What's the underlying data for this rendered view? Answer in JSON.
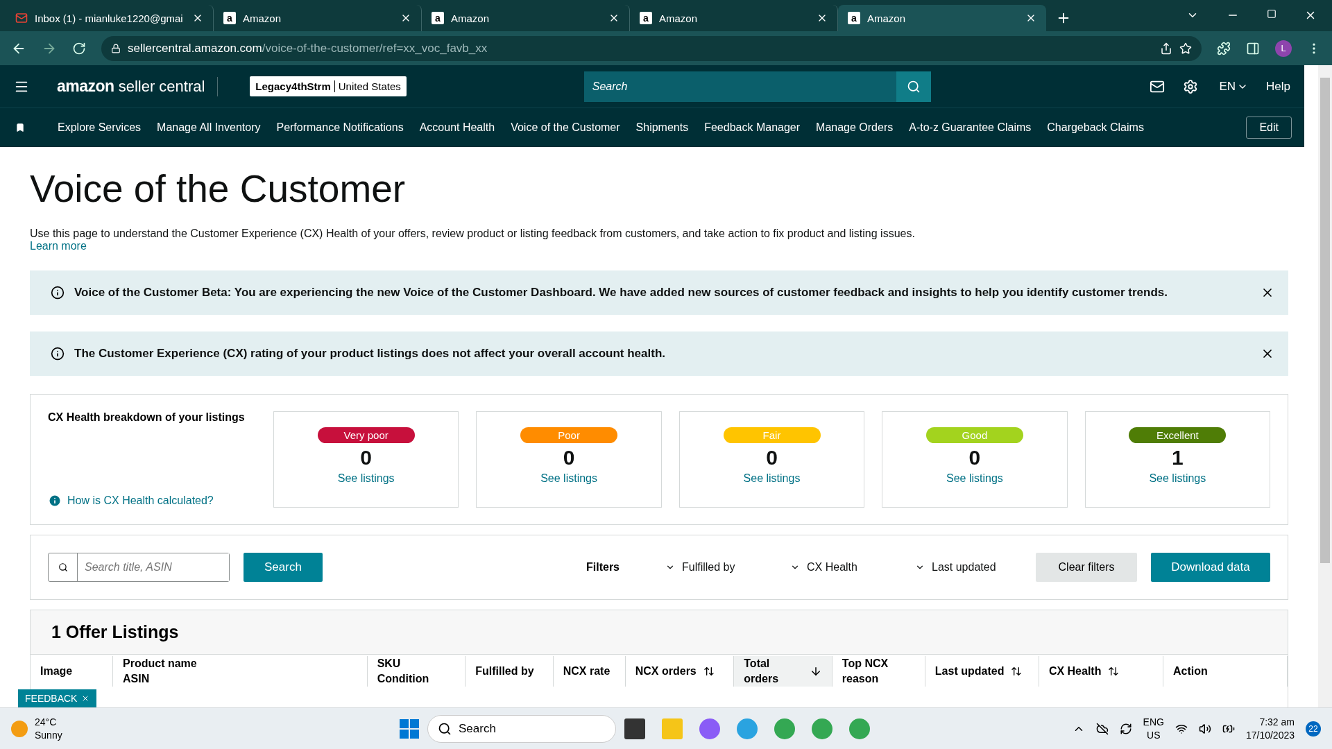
{
  "browser": {
    "tabs": [
      {
        "kind": "mail",
        "title": "Inbox (1) - mianluke1220@gmai",
        "selected": false
      },
      {
        "kind": "amazon",
        "favicon": "a",
        "title": "Amazon",
        "selected": false
      },
      {
        "kind": "amazon",
        "favicon": "a",
        "title": "Amazon",
        "selected": false
      },
      {
        "kind": "amazon",
        "favicon": "a",
        "title": "Amazon",
        "selected": false
      },
      {
        "kind": "amazon",
        "favicon": "a",
        "title": "Amazon",
        "selected": true
      }
    ],
    "url_host": "sellercentral.amazon.com",
    "url_path": "/voice-of-the-customer/ref=xx_voc_favb_xx",
    "profile": "L"
  },
  "header": {
    "logo_main": "amazon",
    "logo_sub": "seller central",
    "store": "Legacy4thStrm",
    "marketplace": "United States",
    "search_placeholder": "Search",
    "language": "EN",
    "help": "Help"
  },
  "nav": {
    "items": [
      "Explore Services",
      "Manage All Inventory",
      "Performance Notifications",
      "Account Health",
      "Voice of the Customer",
      "Shipments",
      "Feedback Manager",
      "Manage Orders",
      "A-to-z Guarantee Claims",
      "Chargeback Claims"
    ],
    "edit": "Edit"
  },
  "page": {
    "title": "Voice of the Customer",
    "intro": "Use this page to understand the Customer Experience (CX) Health of your offers, review product or listing feedback from customers, and take action to fix product and listing issues.",
    "learn_more": "Learn more",
    "alerts": [
      "Voice of the Customer Beta: You are experiencing the new Voice of the Customer Dashboard. We have added new sources of customer feedback and insights to help you identify customer trends.",
      "The Customer Experience (CX) rating of your product listings does not affect your overall account health."
    ]
  },
  "breakdown": {
    "title": "CX Health breakdown of your listings",
    "help_link": "How is CX Health calculated?",
    "cards": [
      {
        "label": "Very poor",
        "color": "#c7103c",
        "count": "0",
        "link": "See listings"
      },
      {
        "label": "Poor",
        "color": "#ff8c00",
        "count": "0",
        "link": "See listings"
      },
      {
        "label": "Fair",
        "color": "#ffc400",
        "count": "0",
        "link": "See listings"
      },
      {
        "label": "Good",
        "color": "#a3d31e",
        "count": "0",
        "link": "See listings"
      },
      {
        "label": "Excellent",
        "color": "#4f7d06",
        "count": "1",
        "link": "See listings"
      }
    ]
  },
  "filters": {
    "search_placeholder": "Search title, ASIN",
    "search_button": "Search",
    "label": "Filters",
    "dropdowns": [
      "Fulfilled by",
      "CX Health",
      "Last updated"
    ],
    "clear": "Clear filters",
    "download": "Download data"
  },
  "listings": {
    "title": "1 Offer Listings",
    "columns": [
      {
        "lines": [
          "Image"
        ],
        "sortable": false,
        "selected": false
      },
      {
        "lines": [
          "Product name",
          "ASIN"
        ],
        "sortable": false,
        "selected": false
      },
      {
        "lines": [
          "SKU",
          "Condition"
        ],
        "sortable": false,
        "selected": false
      },
      {
        "lines": [
          "Fulfilled by"
        ],
        "sortable": false,
        "selected": false
      },
      {
        "lines": [
          "NCX rate"
        ],
        "sortable": false,
        "selected": false
      },
      {
        "lines": [
          "NCX orders"
        ],
        "sortable": true,
        "selected": false
      },
      {
        "lines": [
          "Total",
          "orders"
        ],
        "sortable": true,
        "selected": true
      },
      {
        "lines": [
          "Top NCX",
          "reason"
        ],
        "sortable": false,
        "selected": false
      },
      {
        "lines": [
          "Last updated"
        ],
        "sortable": true,
        "selected": false
      },
      {
        "lines": [
          "CX Health"
        ],
        "sortable": true,
        "selected": false
      },
      {
        "lines": [
          "Action"
        ],
        "sortable": false,
        "selected": false
      }
    ]
  },
  "feedback_tab": "FEEDBACK",
  "taskbar": {
    "temperature": "24°C",
    "weather": "Sunny",
    "search": "Search",
    "lang": "ENG",
    "region": "US",
    "time": "7:32 am",
    "date": "17/10/2023",
    "notifications": "22"
  }
}
